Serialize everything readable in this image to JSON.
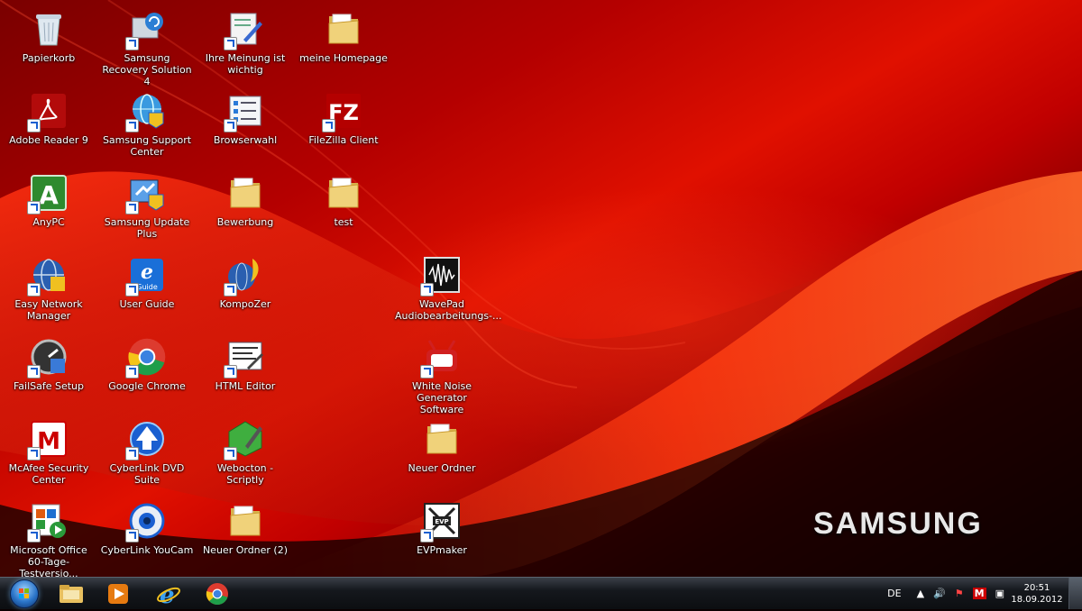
{
  "desktop": {
    "brand": "SAMSUNG",
    "icons": [
      {
        "label": "Papierkorb",
        "icon": "recycle-bin-icon"
      },
      {
        "label": "Adobe Reader 9",
        "icon": "adobe-reader-icon"
      },
      {
        "label": "AnyPC",
        "icon": "anypc-icon"
      },
      {
        "label": "Easy Network Manager",
        "icon": "network-manager-icon"
      },
      {
        "label": "FailSafe Setup",
        "icon": "failsafe-icon"
      },
      {
        "label": "McAfee Security Center",
        "icon": "mcafee-icon"
      },
      {
        "label": "Microsoft Office 60-Tage-Testversio...",
        "icon": "office-icon"
      },
      {
        "label": "Samsung Recovery Solution 4",
        "icon": "recovery-icon"
      },
      {
        "label": "Samsung Support Center",
        "icon": "support-center-icon"
      },
      {
        "label": "Samsung Update Plus",
        "icon": "update-plus-icon"
      },
      {
        "label": "User Guide",
        "icon": "user-guide-icon"
      },
      {
        "label": "Google Chrome",
        "icon": "chrome-icon"
      },
      {
        "label": "CyberLink DVD Suite",
        "icon": "dvd-suite-icon"
      },
      {
        "label": "CyberLink YouCam",
        "icon": "youcam-icon"
      },
      {
        "label": "Ihre Meinung ist wichtig",
        "icon": "feedback-icon"
      },
      {
        "label": "Browserwahl",
        "icon": "browser-choice-icon"
      },
      {
        "label": "Bewerbung",
        "icon": "folder-icon"
      },
      {
        "label": "KompoZer",
        "icon": "kompozer-icon"
      },
      {
        "label": "HTML Editor",
        "icon": "html-editor-icon"
      },
      {
        "label": "Webocton - Scriptly",
        "icon": "scriptly-icon"
      },
      {
        "label": "Neuer Ordner (2)",
        "icon": "folder-icon"
      },
      {
        "label": "meine Homepage",
        "icon": "folder-icon"
      },
      {
        "label": "FileZilla Client",
        "icon": "filezilla-icon"
      },
      {
        "label": "test",
        "icon": "folder-icon"
      },
      {
        "label": "WavePad Audiobearbeitungs-...",
        "icon": "wavepad-icon"
      },
      {
        "label": "White Noise Generator Software",
        "icon": "white-noise-icon"
      },
      {
        "label": "Neuer Ordner",
        "icon": "folder-icon"
      },
      {
        "label": "EVPmaker",
        "icon": "evpmaker-icon"
      }
    ]
  },
  "taskbar": {
    "pinned": [
      {
        "name": "start-button",
        "icon": "windows-logo-icon"
      },
      {
        "name": "explorer",
        "icon": "folder-library-icon"
      },
      {
        "name": "media-player",
        "icon": "media-player-icon"
      },
      {
        "name": "internet-explorer",
        "icon": "ie-icon"
      },
      {
        "name": "chrome",
        "icon": "chrome-icon"
      }
    ],
    "tray": {
      "language": "DE",
      "time": "20:51",
      "date": "18.09.2012"
    }
  },
  "colors": {
    "wallpaper_red": "#e01000",
    "wallpaper_dark": "#1a0000",
    "taskbar": "#15181d"
  }
}
